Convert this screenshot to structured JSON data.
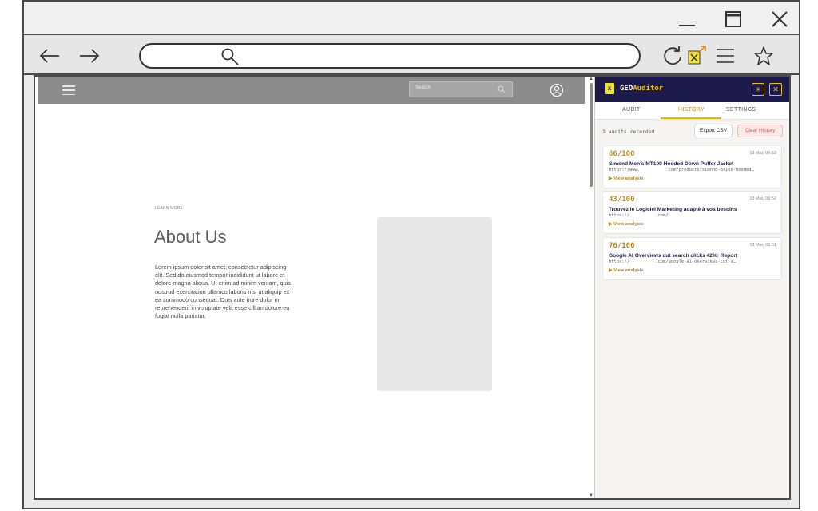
{
  "browser": {
    "minimize_icon": "minimize-icon",
    "maximize_icon": "maximize-icon",
    "close_icon": "close-icon",
    "back_icon": "back-arrow-icon",
    "forward_icon": "forward-arrow-icon",
    "url_search_icon": "search-icon",
    "reload_icon": "reload-icon",
    "menu_icon": "menu-icon",
    "bookmark_icon": "star-icon"
  },
  "site": {
    "search_placeholder": "Search",
    "learn_more": "LEARN MORE",
    "about_title": "About Us",
    "about_body": "Lorem ipsum dolor sit amet, consectetur adipiscing elit. Sed do eiusmod tempor incididunt ut labore et dolore magna aliqua. Ut enim ad minim veniam, quis nostrud exercitation ullamco laboris nisi ut aliquip ex ea commodo consequat. Duis aute irure dolor in reprehenderit in voluptate velit esse cillum dolore eu fugiat nulla pariatur."
  },
  "extension": {
    "title_geo": "GEO",
    "title_auditor": "Auditor",
    "logo_glyph": "x",
    "tabs": [
      {
        "label": "AUDIT",
        "active": false
      },
      {
        "label": "HISTORY",
        "active": true
      },
      {
        "label": "SETTINGS",
        "active": false
      }
    ],
    "audit_count": "3 audits recorded",
    "export_label": "Export CSV",
    "clear_label": "Clear History",
    "view_label": "▶ View analysis",
    "accent_color": "#f2c200",
    "header_color": "#1c1a4a",
    "history": [
      {
        "score": "66/100",
        "date": "13 Mar, 09:53",
        "title": "Simond Men's MT100 Hooded Down Puffer Jacket",
        "url": "https://www.          .com/products/simond-mt100-hooded…"
      },
      {
        "score": "43/100",
        "date": "13 Mar, 09:52",
        "title": "Trouvez le Logiciel Marketing adapté à vos besoins",
        "url": "https://          .com/"
      },
      {
        "score": "76/100",
        "date": "13 Mar, 09:51",
        "title": "Google AI Overviews cut search clicks 42%: Report",
        "url": "https://          .com/google-ai-overviews-cut-s…"
      }
    ]
  }
}
